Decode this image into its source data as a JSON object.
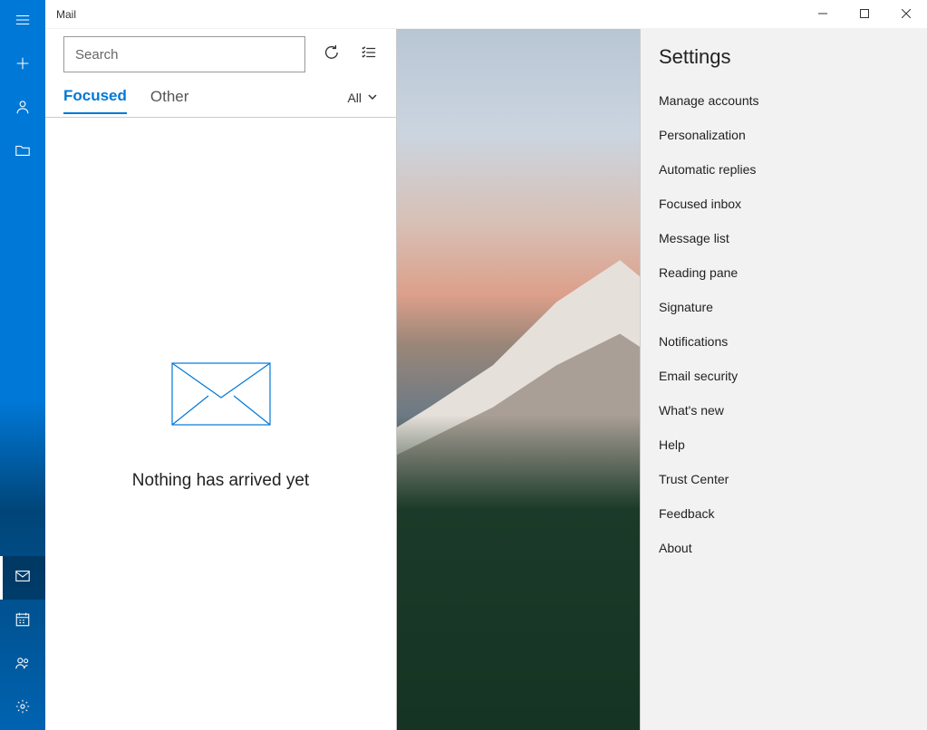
{
  "window": {
    "title": "Mail"
  },
  "sidebar": {
    "top": [
      {
        "name": "hamburger",
        "icon": "menu"
      },
      {
        "name": "new-mail",
        "icon": "plus"
      },
      {
        "name": "accounts",
        "icon": "person"
      },
      {
        "name": "folders",
        "icon": "folder"
      }
    ],
    "bottom": [
      {
        "name": "mail-app",
        "icon": "mail",
        "active": true
      },
      {
        "name": "calendar-app",
        "icon": "calendar"
      },
      {
        "name": "people-app",
        "icon": "people"
      },
      {
        "name": "settings-app",
        "icon": "gear"
      }
    ]
  },
  "search": {
    "placeholder": "Search"
  },
  "tabs": {
    "items": [
      {
        "label": "Focused",
        "active": true
      },
      {
        "label": "Other",
        "active": false
      }
    ],
    "filter_label": "All"
  },
  "empty": {
    "message": "Nothing has arrived yet"
  },
  "settings": {
    "title": "Settings",
    "items": [
      "Manage accounts",
      "Personalization",
      "Automatic replies",
      "Focused inbox",
      "Message list",
      "Reading pane",
      "Signature",
      "Notifications",
      "Email security",
      "What's new",
      "Help",
      "Trust Center",
      "Feedback",
      "About"
    ]
  }
}
